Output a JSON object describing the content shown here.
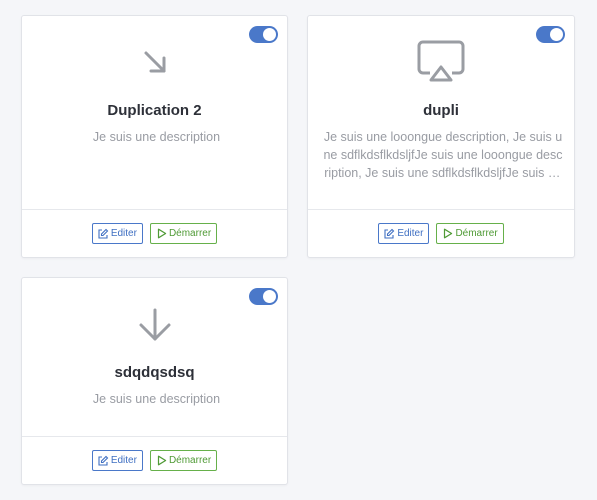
{
  "colors": {
    "accent": "#4a78c9",
    "start_green": "#66b04a",
    "icon_gray": "#9a9da3",
    "background": "#f5f6f9"
  },
  "cards": [
    {
      "icon": "arrow-down-right-icon",
      "title": "Duplication 2",
      "description": "Je suis une description",
      "enabled": true,
      "edit_label": "Editer",
      "start_label": "Démarrer"
    },
    {
      "icon": "airplay-icon",
      "title": "dupli",
      "description": "Je suis une looongue description, Je suis une sdflkdsflkdsljfJe suis une looongue description, Je suis une sdflkdsflkdsljfJe suis une looongue description",
      "enabled": true,
      "edit_label": "Editer",
      "start_label": "Démarrer"
    },
    {
      "icon": "arrow-down-icon",
      "title": "sdqdqsdsq",
      "description": "Je suis une description",
      "enabled": true,
      "edit_label": "Editer",
      "start_label": "Démarrer"
    }
  ]
}
